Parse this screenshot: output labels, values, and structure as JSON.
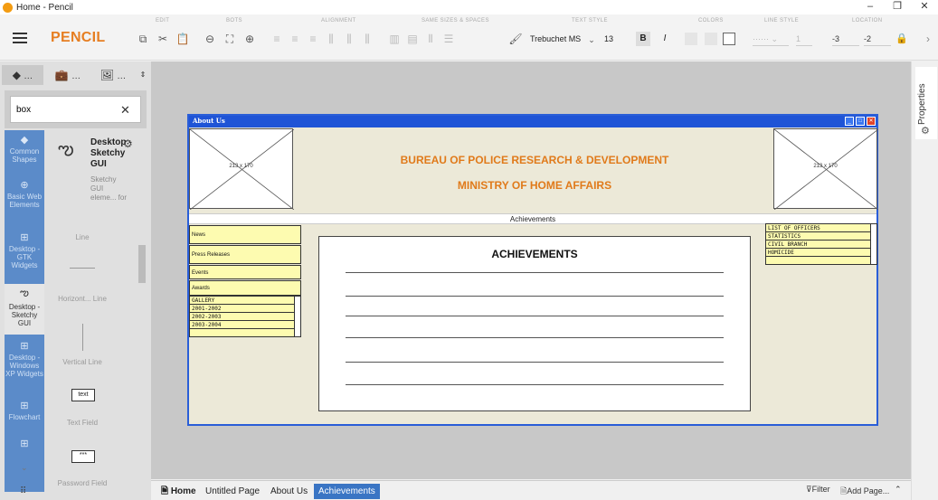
{
  "window": {
    "title": "Home - Pencil",
    "controls": [
      "–",
      "❐",
      "✕"
    ]
  },
  "toolbar": {
    "brand": "PENCIL",
    "groups": [
      "EDIT",
      "BOTS",
      "ALIGNMENT",
      "SAME SIZES & SPACES",
      "TEXT STYLE",
      "COLORS",
      "LINE STYLE",
      "LOCATION"
    ],
    "font_family": "Trebuchet MS",
    "font_size": "13",
    "bold_label": "B",
    "italic_label": "I",
    "line_width": "1",
    "loc_x": "-3",
    "loc_y": "-2"
  },
  "left_panel": {
    "search_value": "box",
    "collections": [
      {
        "icon": "layers-icon",
        "label": "Common Shapes"
      },
      {
        "icon": "globe-icon",
        "label": "Basic Web Elements"
      },
      {
        "icon": "grid-icon",
        "label": "Desktop - GTK Widgets"
      },
      {
        "icon": "squiggle-icon",
        "label": "Desktop - Sketchy GUI"
      },
      {
        "icon": "grid-icon",
        "label": "Desktop - Windows XP Widgets"
      },
      {
        "icon": "grid-icon",
        "label": "Flowchart"
      },
      {
        "icon": "grid-icon",
        "label": ""
      }
    ],
    "shape_group_title": "Desktop - Sketchy GUI",
    "shape_group_desc": "Sketchy GUI eleme... for",
    "shapes": [
      "Line",
      "Horizont... Line",
      "Vertical Line",
      "Text Field",
      "Password Field"
    ],
    "shape_previews": {
      "text": "text",
      "password": "***"
    }
  },
  "right_panel": {
    "properties_label": "Properties"
  },
  "mockup": {
    "window_title": "About Us",
    "image_label": "213 x 170",
    "heading_1": "BUREAU OF POLICE RESEARCH & DEVELOPMENT",
    "heading_2": "MINISTRY OF HOME AFFAIRS",
    "breadcrumb": "Achievements",
    "left_notes": [
      "News",
      "Press Releases",
      "Events",
      "Awards"
    ],
    "gallery_list": [
      "GALLERY",
      "2001-2002",
      "2002-2003",
      "2003-2004"
    ],
    "right_list": [
      "LIST OF OFFICERS",
      "STATISTICS",
      "CIVIL BRANCH",
      "HOMICIDE"
    ],
    "content_title": "ACHIEVEMENTS"
  },
  "pages": {
    "home_label": "Home",
    "tabs": [
      "Untitled Page",
      "About Us",
      "Achievements"
    ],
    "active_tab": "Achievements",
    "filter_label": "Filter",
    "add_page_label": "Add Page..."
  }
}
